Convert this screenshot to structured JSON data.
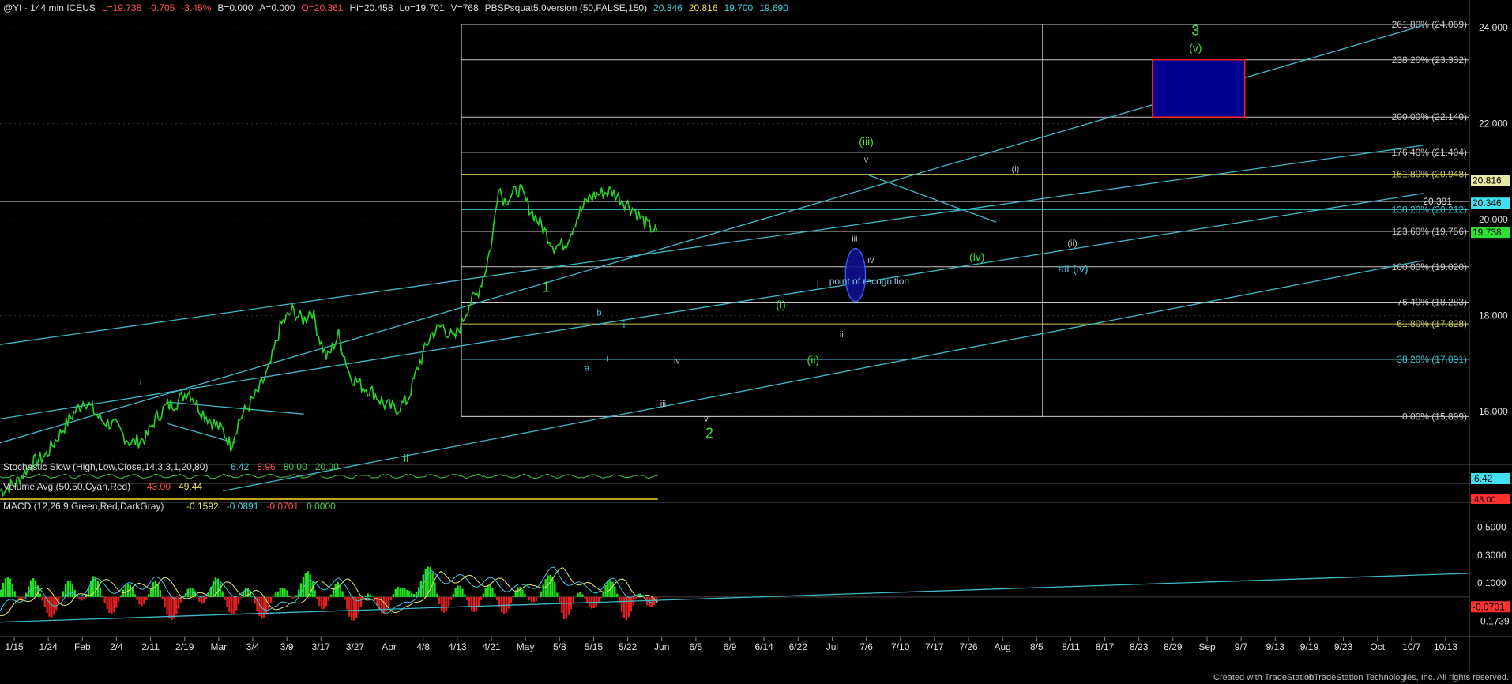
{
  "header": {
    "symbol": "@YI - 144 min  ICEUS",
    "stats": [
      {
        "text": "L=19.738",
        "color": "#ff5050"
      },
      {
        "text": "-0.705",
        "color": "#ff5050"
      },
      {
        "text": "-3.45%",
        "color": "#ff5050"
      },
      {
        "text": "B=0.000",
        "color": "#dddddd"
      },
      {
        "text": "A=0.000",
        "color": "#dddddd"
      },
      {
        "text": "O=20.361",
        "color": "#ff5050"
      },
      {
        "text": "Hi=20.458",
        "color": "#dddddd"
      },
      {
        "text": "Lo=19.701",
        "color": "#dddddd"
      },
      {
        "text": "V=768",
        "color": "#dddddd"
      },
      {
        "text": "PBSPsquat5.0version (50,FALSE,150)",
        "color": "#dddddd"
      },
      {
        "text": "20.346",
        "color": "#40d0e0"
      },
      {
        "text": "20.816",
        "color": "#e0e060"
      },
      {
        "text": "19.700",
        "color": "#40d0e0"
      },
      {
        "text": "19.690",
        "color": "#40d0e0"
      }
    ]
  },
  "chart_data": {
    "type": "line",
    "title": "@YI - 144 min ICEUS",
    "ylim": [
      15.0,
      24.25
    ],
    "price_ticks": [
      "24.000",
      "22.000",
      "20.000",
      "18.000",
      "16.000"
    ],
    "price_tick_values": [
      24,
      22,
      20,
      18,
      16
    ],
    "x_ticks": [
      "1/15",
      "1/24",
      "Feb",
      "2/4",
      "2/11",
      "2/19",
      "Mar",
      "3/4",
      "3/9",
      "3/17",
      "3/27",
      "Apr",
      "4/8",
      "4/13",
      "4/21",
      "May",
      "5/8",
      "5/15",
      "5/22",
      "Jun",
      "6/5",
      "6/9",
      "6/14",
      "6/22",
      "Jul",
      "7/6",
      "7/10",
      "7/17",
      "7/26",
      "Aug",
      "8/5",
      "8/11",
      "8/17",
      "8/23",
      "8/29",
      "Sep",
      "9/7",
      "9/13",
      "9/19",
      "9/23",
      "Oct",
      "10/7",
      "10/13"
    ],
    "price_path_index": [
      0,
      20,
      40,
      60,
      80,
      95,
      110,
      130,
      150,
      170,
      190,
      200,
      215,
      230,
      245,
      260,
      275,
      290,
      300,
      310,
      320,
      335,
      350,
      365,
      380,
      395,
      405,
      415,
      425,
      440,
      455,
      470,
      485,
      500,
      515,
      530,
      545,
      560,
      575,
      590,
      600,
      610,
      620,
      630,
      640,
      648,
      655,
      665,
      675,
      690,
      705,
      720,
      735,
      750,
      765,
      780,
      795,
      810,
      825,
      840,
      855
    ],
    "price_path": [
      14.35,
      14.5,
      14.9,
      15.1,
      15.6,
      15.95,
      16.25,
      15.85,
      15.7,
      15.35,
      15.45,
      15.8,
      16.1,
      16.2,
      16.45,
      16.05,
      15.8,
      15.6,
      15.3,
      15.8,
      16.05,
      16.4,
      16.9,
      17.8,
      18.1,
      17.9,
      18.15,
      17.55,
      17.1,
      17.6,
      16.75,
      16.55,
      16.4,
      16.15,
      16.05,
      16.25,
      17.0,
      17.6,
      17.8,
      17.5,
      17.85,
      18.25,
      18.45,
      18.9,
      19.6,
      20.75,
      20.4,
      20.5,
      20.65,
      20.2,
      19.85,
      19.45,
      19.5,
      20.05,
      20.45,
      20.55,
      20.6,
      20.4,
      20.2,
      19.9,
      19.738
    ],
    "fib_levels": [
      {
        "label": "261.80% (24.069)",
        "value": 24.069,
        "color": "#c8c8c8"
      },
      {
        "label": "238.20% (23.332)",
        "value": 23.332,
        "color": "#c8c8c8"
      },
      {
        "label": "200.00% (22.140)",
        "value": 22.14,
        "color": "#c8c8c8"
      },
      {
        "label": "176.40% (21.404)",
        "value": 21.404,
        "color": "#c8c8c8"
      },
      {
        "label": "161.80% (20.948)",
        "value": 20.948,
        "color": "#c8c85a"
      },
      {
        "label": "138.20% (20.212)",
        "value": 20.212,
        "color": "#40c0d0"
      },
      {
        "label": "123.60% (19.756)",
        "value": 19.756,
        "color": "#c8c8c8"
      },
      {
        "label": "100.00% (19.020)",
        "value": 19.02,
        "color": "#c8c8c8"
      },
      {
        "label": "76.40% (18.283)",
        "value": 18.283,
        "color": "#c8c8c8"
      },
      {
        "label": "61.80% (17.828)",
        "value": 17.828,
        "color": "#c8c85a"
      },
      {
        "label": "38.20% (17.091)",
        "value": 17.091,
        "color": "#40c0d0"
      },
      {
        "label": "0.00% (15.899)",
        "value": 15.899,
        "color": "#c8c8c8"
      }
    ],
    "price_markers": [
      {
        "text": "20.816",
        "value": 20.816,
        "bg": "#e8e8a0",
        "fg": "#000000"
      },
      {
        "text": "20.346",
        "value": 20.346,
        "bg": "#40e0f0",
        "fg": "#000000"
      },
      {
        "text": "19.738",
        "value": 19.738,
        "bg": "#30e030",
        "fg": "#000000"
      }
    ],
    "reference_label": {
      "text": "20.381",
      "value": 20.381
    },
    "wave_labels": [
      {
        "text": "3",
        "index": 1554,
        "price": 23.85,
        "color": "#40e040",
        "size": 18
      },
      {
        "text": "(v)",
        "index": 1554,
        "price": 23.5,
        "color": "#40e040",
        "size": 14
      },
      {
        "text": "(iii)",
        "index": 1126,
        "price": 21.55,
        "color": "#40e040",
        "size": 14
      },
      {
        "text": "(i)",
        "index": 1320,
        "price": 21.0,
        "color": "#c0c0c0",
        "size": 11
      },
      {
        "text": "(ii)",
        "index": 1394,
        "price": 19.45,
        "color": "#c0c0c0",
        "size": 11
      },
      {
        "text": "(iv)",
        "index": 1270,
        "price": 19.15,
        "color": "#40e040",
        "size": 14
      },
      {
        "text": "alt (iv)",
        "index": 1395,
        "price": 18.9,
        "color": "#40c8e0",
        "size": 14
      },
      {
        "text": "point of recognition",
        "index": 1130,
        "price": 18.65,
        "color": "#80c8e0",
        "size": 12
      },
      {
        "text": "1",
        "index": 710,
        "price": 18.5,
        "color": "#40e040",
        "size": 18
      },
      {
        "text": "2",
        "index": 922,
        "price": 15.45,
        "color": "#40e040",
        "size": 18
      },
      {
        "text": "ii",
        "index": 528,
        "price": 14.95,
        "color": "#40e040",
        "size": 14
      },
      {
        "text": "i",
        "index": 183,
        "price": 16.55,
        "color": "#40e040",
        "size": 14
      },
      {
        "text": "(i)",
        "index": 1015,
        "price": 18.15,
        "color": "#40e040",
        "size": 14
      },
      {
        "text": "(ii)",
        "index": 1057,
        "price": 17.0,
        "color": "#40e040",
        "size": 14
      },
      {
        "text": "i",
        "index": 1063,
        "price": 18.6,
        "color": "#c0c0c0",
        "size": 11
      },
      {
        "text": "ii",
        "index": 1094,
        "price": 17.55,
        "color": "#c0c0c0",
        "size": 11
      },
      {
        "text": "iii",
        "index": 1111,
        "price": 19.55,
        "color": "#c0c0c0",
        "size": 11
      },
      {
        "text": "iv",
        "index": 1132,
        "price": 19.1,
        "color": "#c0c0c0",
        "size": 11
      },
      {
        "text": "v",
        "index": 1126,
        "price": 21.2,
        "color": "#c0c0c0",
        "size": 11
      },
      {
        "text": "a",
        "index": 763,
        "price": 16.85,
        "color": "#40c8e0",
        "size": 11
      },
      {
        "text": "b",
        "index": 779,
        "price": 18.0,
        "color": "#40c8e0",
        "size": 11
      },
      {
        "text": "i",
        "index": 790,
        "price": 17.05,
        "color": "#40c8e0",
        "size": 11
      },
      {
        "text": "ii",
        "index": 810,
        "price": 17.75,
        "color": "#40c8e0",
        "size": 11
      },
      {
        "text": "iii",
        "index": 862,
        "price": 16.1,
        "color": "#c0c0c0",
        "size": 11
      },
      {
        "text": "iv",
        "index": 880,
        "price": 17.0,
        "color": "#c0c0c0",
        "size": 11
      },
      {
        "text": "v",
        "index": 918,
        "price": 15.8,
        "color": "#c0c0c0",
        "size": 11
      }
    ],
    "target_box": {
      "from_index": 1498,
      "to_index": 1618,
      "top": 23.332,
      "bottom": 22.14,
      "fill": "#000090",
      "border": "#ff2020"
    },
    "recognition_ellipse": {
      "index": 1112,
      "price": 18.85,
      "rx_index": 13,
      "ry_price": 0.55
    },
    "channels": [
      {
        "i1": 0,
        "p1": 15.35,
        "i2": 1850,
        "p2": 24.05
      },
      {
        "i1": 0,
        "p1": 17.4,
        "i2": 1850,
        "p2": 21.55
      },
      {
        "i1": 0,
        "p1": 15.85,
        "i2": 1850,
        "p2": 20.55
      },
      {
        "i1": 290,
        "p1": 14.35,
        "i2": 1850,
        "p2": 19.15
      }
    ],
    "fib_box": {
      "from_index": 600,
      "to_index": 1355,
      "top": 24.069,
      "bottom": 15.899
    },
    "trendlines": [
      {
        "i1": 1126,
        "p1": 20.95,
        "i2": 1295,
        "p2": 19.95
      },
      {
        "i1": 218,
        "p1": 16.2,
        "i2": 395,
        "p2": 15.95
      },
      {
        "i1": 218,
        "p1": 15.75,
        "i2": 305,
        "p2": 15.35
      }
    ],
    "stochastic": {
      "label": "Stochastic Slow (High,Low,Close,14,3,3,1,20,80)",
      "values": [
        "6.42",
        "8.96",
        "80.00",
        "20.00"
      ],
      "marker": "6.42"
    },
    "volume": {
      "label": "Volume Avg (50,50,Cyan,Red)",
      "values": [
        "43.00",
        "49.44"
      ],
      "marker": "43.00"
    },
    "macd": {
      "label": "MACD (12,26,9,Green,Red,DarkGray)",
      "values": [
        "-0.1592",
        "-0.0891",
        "-0.0701",
        "0.0000"
      ],
      "ticks": [
        "0.5000",
        "0.3000",
        "0.1000",
        "-0.1739"
      ],
      "tick_values": [
        0.5,
        0.3,
        0.1,
        -0.1739
      ],
      "ylim": [
        -0.25,
        0.6
      ],
      "marker": "-0.0701",
      "channel": {
        "i1": 0,
        "p1": -0.18,
        "i2": 1910,
        "p2": 0.17
      },
      "path_index": [
        0,
        40,
        80,
        120,
        160,
        200,
        240,
        280,
        320,
        360,
        400,
        440,
        480,
        520,
        560,
        600,
        640,
        680,
        720,
        760,
        800,
        840,
        880,
        920,
        960,
        1000,
        1040,
        1080,
        1100,
        1115,
        1125,
        1140,
        1160,
        1200,
        1240,
        1280,
        1300,
        1320,
        1340,
        1355
      ],
      "path": [
        -0.1,
        0.05,
        -0.05,
        0.1,
        0.05,
        0.12,
        -0.02,
        0.08,
        0.02,
        -0.1,
        0.08,
        0.1,
        -0.05,
        -0.1,
        0.15,
        0.12,
        0.1,
        0.05,
        0.18,
        0.05,
        0.1,
        -0.05,
        0.1,
        -0.1,
        0.05,
        0.1,
        0.12,
        0.05,
        0.1,
        0.3,
        0.55,
        0.3,
        0.05,
        0.0,
        -0.05,
        -0.12,
        0.15,
        0.1,
        0.08,
        -0.16
      ]
    },
    "copyright": {
      "left": "Created with TradeStation.",
      "right": "©TradeStation Technologies, Inc. All rights reserved."
    }
  }
}
